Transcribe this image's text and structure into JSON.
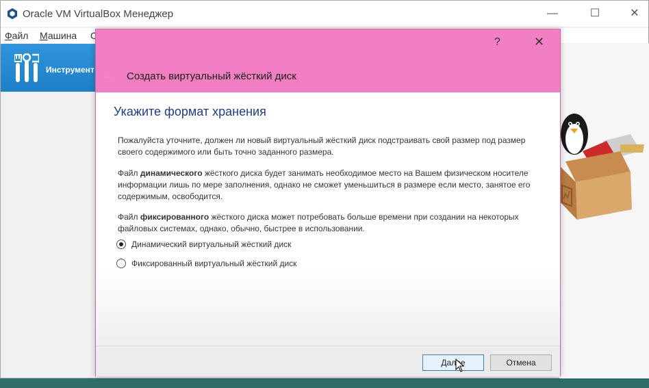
{
  "window": {
    "title": "Oracle VM VirtualBox Менеджер",
    "controls": {
      "minimize": "—",
      "maximize": "☐",
      "close": "✕"
    }
  },
  "menu": {
    "file_u": "Ф",
    "file_rest": "айл",
    "machine_u": "М",
    "machine_rest": "ашина",
    "help": "С"
  },
  "tools": {
    "label": "Инструмент"
  },
  "dialog": {
    "help": "?",
    "close": "✕",
    "back_icon": "←",
    "title": "Создать виртуальный жёсткий диск",
    "heading": "Укажите формат хранения",
    "para1": "Пожалуйста уточните, должен ли новый виртуальный жёсткий диск подстраивать свой размер под размер своего содержимого или быть точно заданного размера.",
    "para2_pre": "Файл ",
    "para2_bold": "динамического",
    "para2_post": " жёсткого диска будет занимать необходимое место на Вашем физическом носителе информации лишь по мере заполнения, однако не сможет уменьшиться в размере если место, занятое его содержимым, освободится.",
    "para3_pre": "Файл ",
    "para3_bold": "фиксированного",
    "para3_post": " жёсткого диска может потребовать больше времени при создании на некоторых файловых системах, однако, обычно, быстрее в использовании.",
    "options": [
      {
        "label": "Динамический виртуальный жёсткий диск",
        "selected": true
      },
      {
        "label": "Фиксированный виртуальный жёсткий диск",
        "selected": false
      }
    ],
    "buttons": {
      "next": "Далее",
      "cancel": "Отмена"
    }
  },
  "colors": {
    "dialog_header": "#f27fc3",
    "heading": "#1f3d87",
    "tools_panel": "#1d7fc6"
  }
}
